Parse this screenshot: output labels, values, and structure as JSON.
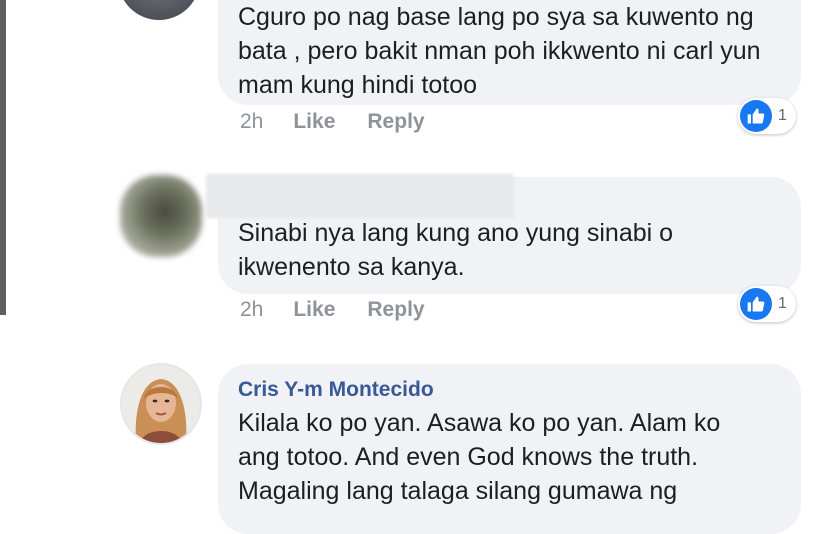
{
  "comments": [
    {
      "text": "Cguro po nag base lang po sya sa kuwento ng\nbata , pero bakit nman poh ikkwento ni carl yun\nmam kung hindi totoo",
      "time": "2h",
      "like_label": "Like",
      "reply_label": "Reply",
      "reaction_count": "1"
    },
    {
      "text": "Sinabi nya lang kung ano yung sinabi o\nikwenento sa kanya.",
      "time": "2h",
      "like_label": "Like",
      "reply_label": "Reply",
      "reaction_count": "1"
    },
    {
      "author": "Cris Y-m Montecido",
      "text": "Kilala ko  po yan. Asawa ko po yan. Alam ko\nang totoo. And even God knows the truth.\nMagaling lang talaga silang gumawa ng"
    }
  ],
  "colors": {
    "bubble": "#f0f2f5",
    "author": "#385898",
    "meta": "#8e939a",
    "like_blue": "#1877f2"
  },
  "icons": [
    "like-thumb-icon"
  ]
}
